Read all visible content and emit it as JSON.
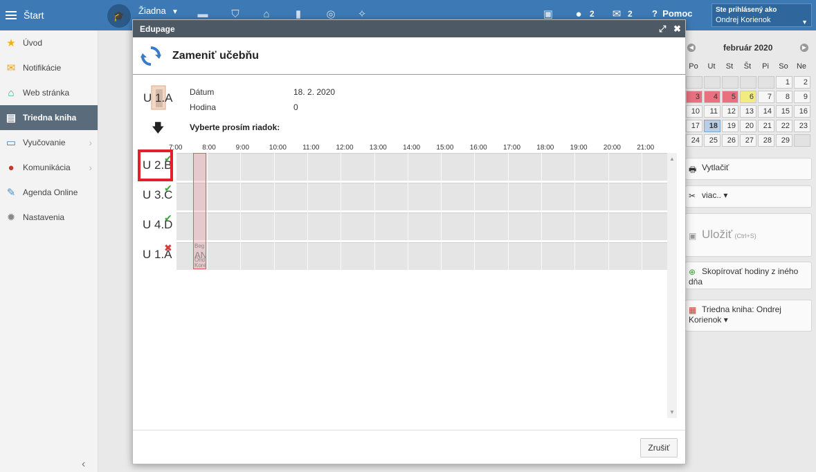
{
  "topbar": {
    "start_label": "Štart",
    "school_label": "Žiadna",
    "messages_count": "2",
    "mail_count": "2",
    "help_label": "Pomoc",
    "user_line1": "Ste prihlásený ako",
    "user_line2": "Ondrej Korienok"
  },
  "sidebar": {
    "items": [
      {
        "label": "Úvod"
      },
      {
        "label": "Notifikácie"
      },
      {
        "label": "Web stránka"
      },
      {
        "label": "Triedna kniha"
      },
      {
        "label": "Vyučovanie"
      },
      {
        "label": "Komunikácia"
      },
      {
        "label": "Agenda Online"
      },
      {
        "label": "Nastavenia"
      }
    ]
  },
  "calendar": {
    "title": "február 2020",
    "day_names": [
      "Po",
      "Ut",
      "St",
      "Št",
      "Pi",
      "So",
      "Ne"
    ],
    "weeks": [
      [
        "",
        "",
        "",
        "",
        "",
        "1",
        "2"
      ],
      [
        "3",
        "4",
        "5",
        "6",
        "7",
        "8",
        "9"
      ],
      [
        "10",
        "11",
        "12",
        "13",
        "14",
        "15",
        "16"
      ],
      [
        "17",
        "18",
        "19",
        "20",
        "21",
        "22",
        "23"
      ],
      [
        "24",
        "25",
        "26",
        "27",
        "28",
        "29",
        ""
      ]
    ],
    "red_days": [
      "3",
      "4",
      "5"
    ],
    "yellow_days": [
      "6"
    ],
    "today": "18"
  },
  "right_actions": {
    "print_label": "Vytlačiť",
    "more_label": "viac.. ▾",
    "save_label": "Uložiť",
    "save_hint": "(Ctrl+S)",
    "copy_label": "Skopírovať hodiny z iného dňa",
    "class_book_label": "Triedna kniha: Ondrej Korienok ▾"
  },
  "modal": {
    "window_title": "Edupage",
    "heading": "Zameniť učebňu",
    "current_room": "U 1.A",
    "date_label": "Dátum",
    "date_value": "18. 2. 2020",
    "hour_label": "Hodina",
    "hour_value": "0",
    "instruction": "Vyberte prosím riadok:",
    "times": [
      "7:00",
      "8:00",
      "9:00",
      "10:00",
      "11:00",
      "12:00",
      "13:00",
      "14:00",
      "15:00",
      "16:00",
      "17:00",
      "18:00",
      "19:00",
      "20:00",
      "21:00"
    ],
    "rows": [
      {
        "label": "U 2.B",
        "status": "available"
      },
      {
        "label": "U 3.C",
        "status": "available"
      },
      {
        "label": "U 4.D",
        "status": "available"
      },
      {
        "label": "U 1.A",
        "status": "occupied"
      }
    ],
    "occupied_lesson": {
      "line1": "Beg",
      "line2": "AN",
      "line3": "Ond",
      "line4": "Kore"
    },
    "cancel_label": "Zrušiť"
  },
  "colors": {
    "topbar": "#3d7ab5",
    "sidebar_active": "#5a6b7b",
    "modal_titlebar": "#4d5964",
    "highlight": "#e0202a",
    "calendar_red": "#e9707f",
    "calendar_yellow": "#f1ec7f"
  }
}
